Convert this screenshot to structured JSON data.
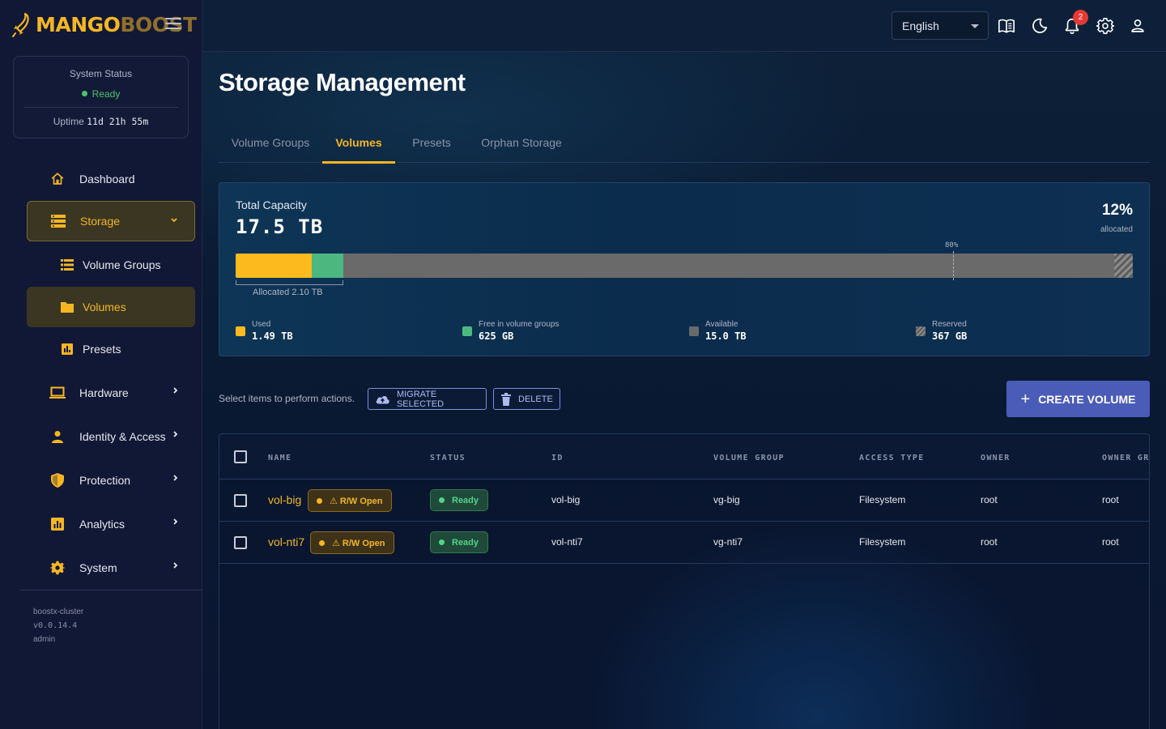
{
  "brand": {
    "part1": "MANGO",
    "part2": "BOOST"
  },
  "sidebar": {
    "status_label": "System Status",
    "status_value": "Ready",
    "uptime_label": "Uptime",
    "uptime_value": "11d 21h 55m",
    "items": [
      {
        "label": "Dashboard",
        "icon": "home-icon"
      },
      {
        "label": "Storage",
        "icon": "storage-icon",
        "expanded": true
      },
      {
        "label": "Volume Groups",
        "icon": "list-icon"
      },
      {
        "label": "Volumes",
        "icon": "folder-icon",
        "active": true
      },
      {
        "label": "Presets",
        "icon": "chart-box-icon"
      },
      {
        "label": "Hardware",
        "icon": "laptop-icon"
      },
      {
        "label": "Identity & Access",
        "icon": "person-icon"
      },
      {
        "label": "Protection",
        "icon": "shield-icon"
      },
      {
        "label": "Analytics",
        "icon": "analytics-icon"
      },
      {
        "label": "System",
        "icon": "gear-icon"
      }
    ],
    "footer": {
      "cluster": "boostx-cluster",
      "version": "v0.0.14.4",
      "user": "admin"
    }
  },
  "topbar": {
    "language": "English",
    "notification_count": "2",
    "icons": [
      "book-icon",
      "moon-icon",
      "bell-icon",
      "settings-icon",
      "account-icon"
    ]
  },
  "page": {
    "title": "Storage Management",
    "tabs": [
      {
        "label": "Volume Groups"
      },
      {
        "label": "Volumes",
        "active": true
      },
      {
        "label": "Presets"
      },
      {
        "label": "Orphan Storage"
      }
    ]
  },
  "capacity": {
    "total_label": "Total Capacity",
    "total_value": "17.5 TB",
    "allocated_pct": "12%",
    "allocated_pct_label": "allocated",
    "marker_label": "80%",
    "marker_fraction": 0.8,
    "allocated_text": "Allocated 2.10 TB",
    "used_fraction": 0.085,
    "free_vg_fraction": 0.035,
    "reserved_fraction": 0.021,
    "colors": {
      "used": "#fdba1e",
      "free_vg": "#4cb880",
      "available": "#6a6a6a"
    },
    "legend": [
      {
        "label": "Used",
        "value": "1.49 TB"
      },
      {
        "label": "Free in volume groups",
        "value": "625 GB"
      },
      {
        "label": "Available",
        "value": "15.0 TB"
      },
      {
        "label": "Reserved",
        "value": "367 GB"
      }
    ]
  },
  "actions": {
    "hint": "Select items to perform actions.",
    "migrate_label": "MIGRATE SELECTED",
    "delete_label": "DELETE",
    "create_label": "CREATE VOLUME"
  },
  "table": {
    "columns": [
      "NAME",
      "STATUS",
      "ID",
      "VOLUME GROUP",
      "ACCESS TYPE",
      "OWNER",
      "OWNER GRO"
    ],
    "rows": [
      {
        "name": "vol-big",
        "badge": "⚠ R/W Open",
        "status": "Ready",
        "id": "vol-big",
        "volume_group": "vg-big",
        "access_type": "Filesystem",
        "owner": "root",
        "owner_group": "root"
      },
      {
        "name": "vol-nti7",
        "badge": "⚠ R/W Open",
        "status": "Ready",
        "id": "vol-nti7",
        "volume_group": "vg-nti7",
        "access_type": "Filesystem",
        "owner": "root",
        "owner_group": "root"
      }
    ]
  }
}
